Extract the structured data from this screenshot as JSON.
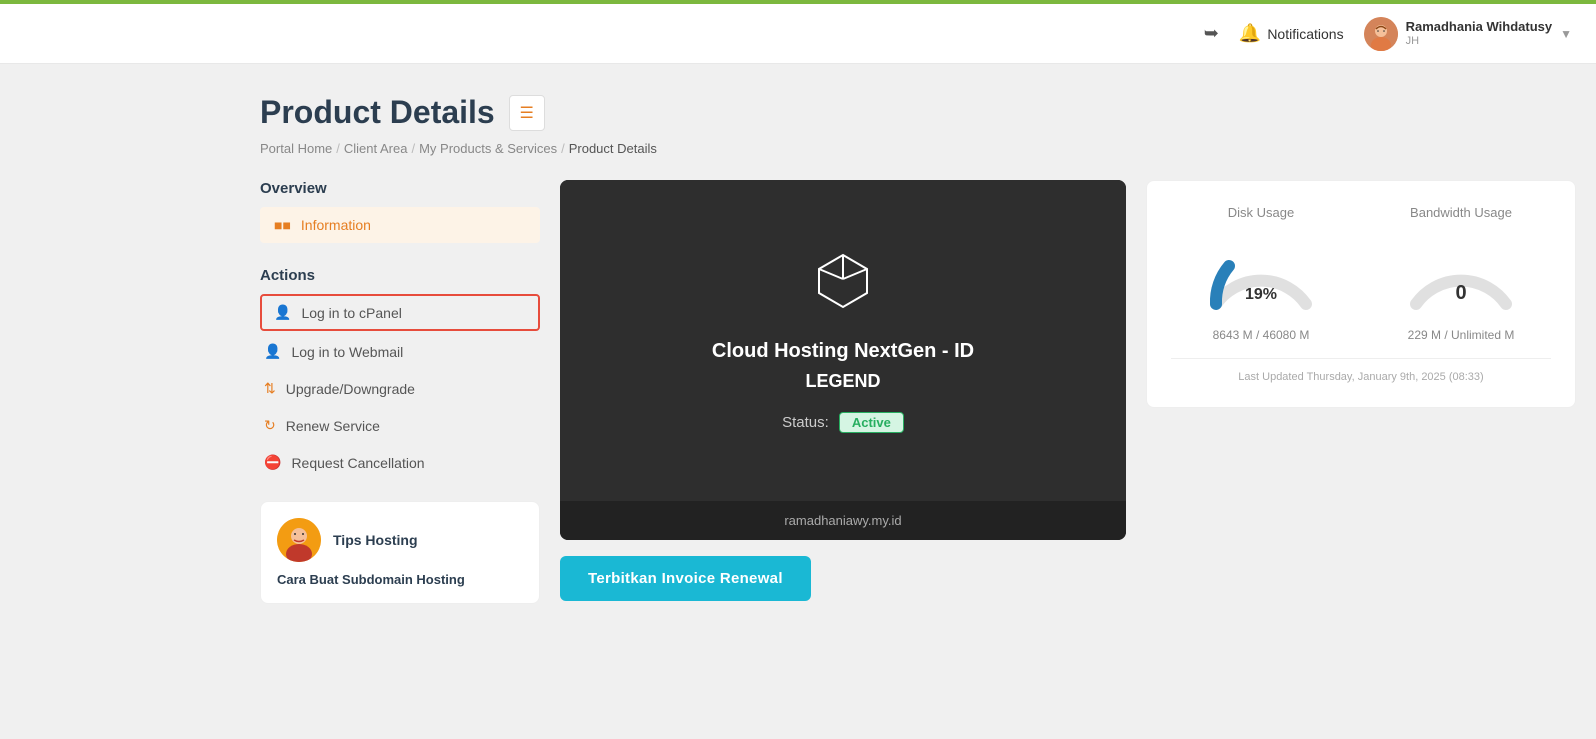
{
  "topbar": {
    "notifications_label": "Notifications",
    "user_name": "Ramadhania Wihdatusy",
    "user_initials": "JH",
    "user_sub": "JH"
  },
  "page": {
    "title": "Product Details",
    "breadcrumbs": [
      {
        "label": "Portal Home",
        "url": "#"
      },
      {
        "label": "Client Area",
        "url": "#"
      },
      {
        "label": "My Products & Services",
        "url": "#"
      },
      {
        "label": "Product Details",
        "url": ""
      }
    ]
  },
  "sidebar": {
    "overview_title": "Overview",
    "information_label": "Information",
    "actions_title": "Actions",
    "actions": [
      {
        "id": "login-cpanel",
        "label": "Log in to cPanel",
        "highlighted": true
      },
      {
        "id": "login-webmail",
        "label": "Log in to Webmail",
        "highlighted": false
      },
      {
        "id": "upgrade-downgrade",
        "label": "Upgrade/Downgrade",
        "highlighted": false
      },
      {
        "id": "renew-service",
        "label": "Renew Service",
        "highlighted": false
      },
      {
        "id": "request-cancellation",
        "label": "Request Cancellation",
        "highlighted": false
      }
    ]
  },
  "tips": {
    "title": "Tips Hosting",
    "subtitle": "Cara Buat Subdomain Hosting"
  },
  "product": {
    "name": "Cloud Hosting NextGen - ID",
    "legend": "LEGEND",
    "status_label": "Status:",
    "status_value": "Active",
    "domain": "ramadhaniawy.my.id"
  },
  "stats": {
    "disk_usage_label": "Disk Usage",
    "bandwidth_usage_label": "Bandwidth Usage",
    "disk_percent": 19,
    "disk_percent_label": "19%",
    "bandwidth_value": "0",
    "disk_numbers": "8643 M / 46080 M",
    "bandwidth_numbers": "229 M / Unlimited M",
    "last_updated": "Last Updated Thursday, January 9th, 2025 (08:33)"
  },
  "invoice": {
    "button_label": "Terbitkan Invoice Renewal"
  }
}
